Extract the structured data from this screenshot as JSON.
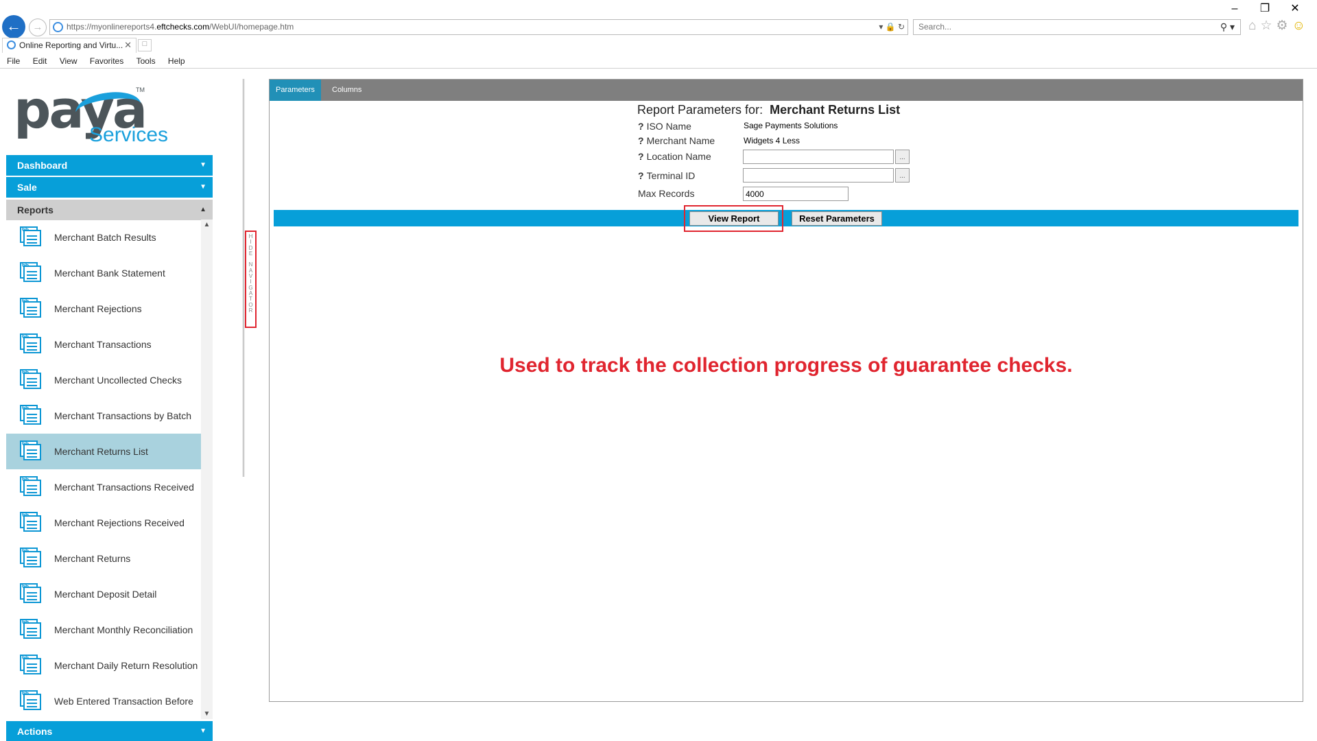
{
  "browser": {
    "url_prefix": "https://myonlinereports4.",
    "url_domain": "eftchecks.com",
    "url_path": "/WebUI/homepage.htm",
    "search_placeholder": "Search...",
    "tab_title": "Online Reporting and Virtu...",
    "menu": [
      "File",
      "Edit",
      "View",
      "Favorites",
      "Tools",
      "Help"
    ]
  },
  "logo": {
    "word": "paya",
    "tm": "TM",
    "services": "Services"
  },
  "nav": {
    "dashboard": "Dashboard",
    "sale": "Sale",
    "reports": "Reports",
    "actions": "Actions",
    "report_items": [
      "Merchant Batch Results",
      "Merchant Bank Statement",
      "Merchant Rejections",
      "Merchant Transactions",
      "Merchant Uncollected Checks",
      "Merchant Transactions by Batch",
      "Merchant Returns List",
      "Merchant Transactions Received",
      "Merchant Rejections Received",
      "Merchant Returns",
      "Merchant Deposit Detail",
      "Merchant Monthly Reconciliation",
      "Merchant Daily Return Resolution",
      "Web Entered Transaction Before"
    ],
    "active_item": "Merchant Returns List",
    "hide_navigator": "HIDE NAVIGATOR"
  },
  "panel": {
    "tabs": {
      "parameters": "Parameters",
      "columns": "Columns"
    },
    "title_prefix": "Report Parameters for:",
    "title_report": "Merchant Returns List",
    "fields": {
      "iso_name_label": "ISO Name",
      "iso_name_value": "Sage Payments Solutions",
      "merchant_name_label": "Merchant Name",
      "merchant_name_value": "Widgets 4 Less",
      "location_name_label": "Location Name",
      "location_name_value": "",
      "terminal_id_label": "Terminal ID",
      "terminal_id_value": "",
      "max_records_label": "Max Records",
      "max_records_value": "4000"
    },
    "help_mark": "?",
    "browse_label": "...",
    "view_report": "View Report",
    "reset_parameters": "Reset Parameters",
    "annotation": "Used to track the collection progress of guarantee checks."
  },
  "colors": {
    "accent": "#079fd9",
    "annotation": "#e0252f",
    "active_item": "#a9d2de"
  }
}
